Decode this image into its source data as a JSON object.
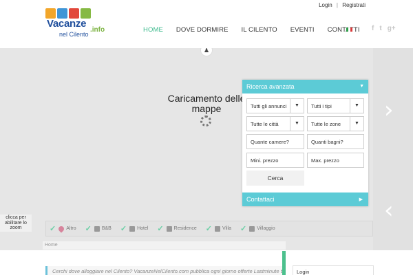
{
  "header": {
    "logo": {
      "line1": "Vacanze",
      "line2": "nel Cilento",
      "suffix": ".info"
    },
    "top_links": {
      "login": "Login",
      "separator": "|",
      "register": "Registrati"
    },
    "nav": [
      {
        "label": "HOME",
        "active": true
      },
      {
        "label": "DOVE DORMIRE"
      },
      {
        "label": "IL CILENTO"
      },
      {
        "label": "EVENTI"
      },
      {
        "label": "CONTATTI"
      }
    ],
    "language_flag": "italian-flag",
    "social": {
      "facebook": "f",
      "twitter": "t",
      "googleplus": "g+"
    }
  },
  "map": {
    "loading_text": "Caricamento delle mappe",
    "zoom_hint": "clicca per abilitare lo zoom",
    "next_arrow": "›",
    "prev_arrow": "‹"
  },
  "search": {
    "title": "Ricerca avanzata",
    "fields": {
      "announcements": "Tutti gli annunci",
      "types": "Tutti i tipi",
      "cities": "Tutte le città",
      "zones": "Tutte le zone",
      "rooms_placeholder": "Quante camere?",
      "baths_placeholder": "Quanti bagni?",
      "min_price_placeholder": "Mini. prezzo",
      "max_price_placeholder": "Max. prezzo"
    },
    "submit": "Cerca",
    "contact": "Contattaci"
  },
  "filters": [
    "Altro",
    "B&B",
    "Hotel",
    "Residence",
    "Villa",
    "Villaggio"
  ],
  "breadcrumb": "Home",
  "intro_text": "Cerchi dove alloggiare nel Cilento? VacanzeNelCilento.com pubblica ogni giorno offerte Lastminute tra",
  "sidebar": {
    "login_title": "Login"
  },
  "colors": {
    "accent": "#5ccbd6",
    "nav_active": "#3cba8c",
    "check": "#6ccfa6",
    "logo_blue": "#1f4e9c"
  }
}
